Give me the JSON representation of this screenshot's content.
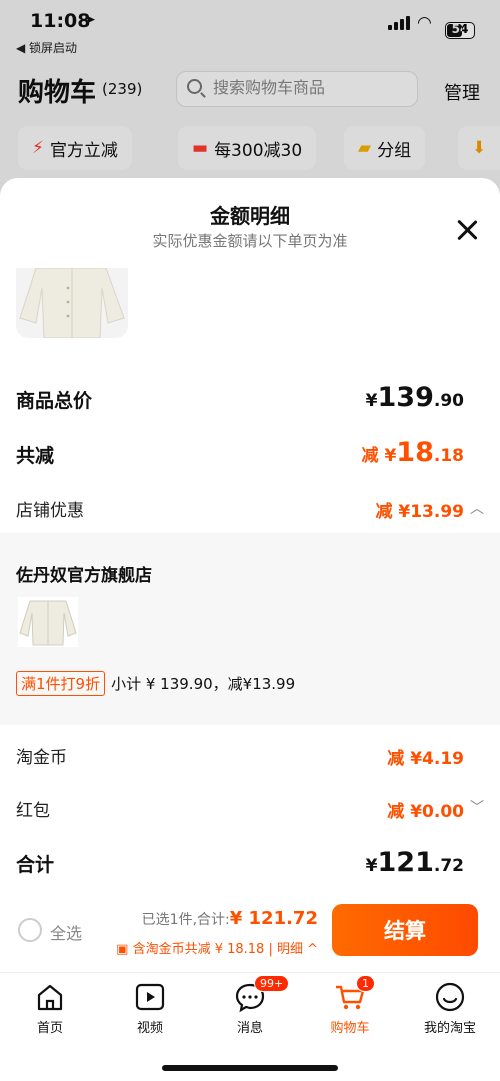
{
  "status": {
    "time": "11:08",
    "back_label": "◀ 锁屏启动",
    "battery": "54"
  },
  "header": {
    "title": "购物车",
    "count": "(239)",
    "search_placeholder": "搜索购物车商品",
    "manage": "管理",
    "chips": [
      "官方立减",
      "每300减30",
      "分组"
    ]
  },
  "sheet": {
    "title": "金额明细",
    "subtitle": "实际优惠金额请以下单页为准",
    "total_label": "商品总价",
    "total_currency": "¥",
    "total_int": "139",
    "total_dec": ".90",
    "reduce_label": "共减",
    "reduce_prefix": "减 ¥",
    "reduce_int": "18",
    "reduce_dec": ".18",
    "shop_label": "店铺优惠",
    "shop_value": "减 ¥13.99",
    "store_name": "佐丹奴官方旗舰店",
    "promo_tag": "满1件打9折",
    "promo_text": "小计 ¥ 139.90，减¥13.99",
    "coin_label": "淘金币",
    "coin_value": "减 ¥4.19",
    "redpack_label": "红包",
    "redpack_value": "减 ¥0.00",
    "sum_label": "合计",
    "sum_currency": "¥",
    "sum_int": "121",
    "sum_dec": ".72"
  },
  "action": {
    "select_all": "全选",
    "selected_text": "已选1件,合计:",
    "selected_sum": "¥ 121.72",
    "coin_line": "含淘金币共减 ¥ 18.18 | 明细 ^",
    "checkout": "结算"
  },
  "tabs": [
    {
      "label": "首页"
    },
    {
      "label": "视频"
    },
    {
      "label": "消息",
      "badge": "99+"
    },
    {
      "label": "购物车",
      "badge": "1"
    },
    {
      "label": "我的淘宝"
    }
  ],
  "colors": {
    "accent": "#ff5000"
  }
}
